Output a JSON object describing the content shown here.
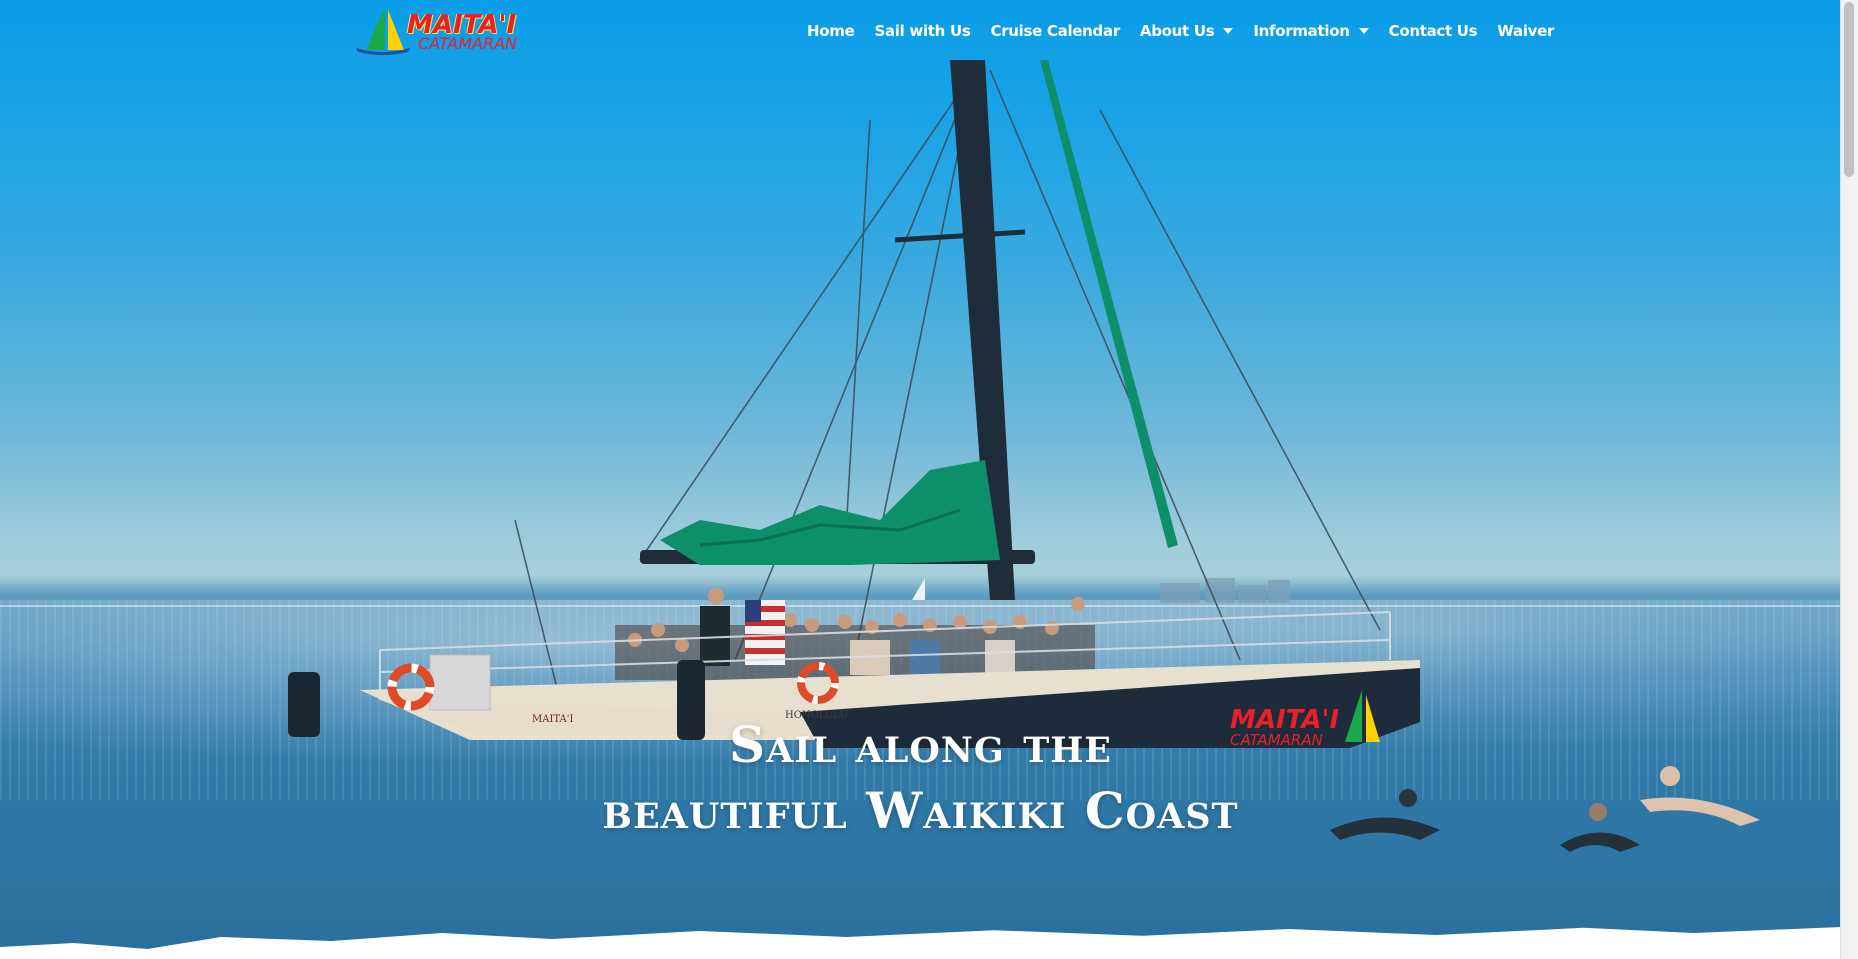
{
  "logo": {
    "top": "MAITA'I",
    "bottom": "CATAMARAN"
  },
  "nav": {
    "items": [
      {
        "label": "Home"
      },
      {
        "label": "Sail with Us"
      },
      {
        "label": "Cruise Calendar"
      },
      {
        "label": "About Us"
      },
      {
        "label": "Information"
      },
      {
        "label": "Contact Us"
      },
      {
        "label": "Waiver"
      }
    ]
  },
  "hero": {
    "headline_line1": "Sail along the",
    "headline_line2": "beautiful Waikiki Coast",
    "boat_hull_name": "MAITA'I",
    "boat_hull_sub": "CATAMARAN",
    "boat_side_name": "MAITA'I",
    "boat_port": "HONOLULU"
  },
  "colors": {
    "sky": "#0b9de8",
    "accent_red": "#e8202a",
    "sail_green": "#0d8f6a",
    "hull": "#1e2b3a"
  },
  "icons": [
    "chevron-down-icon",
    "logo-sail-icon"
  ]
}
